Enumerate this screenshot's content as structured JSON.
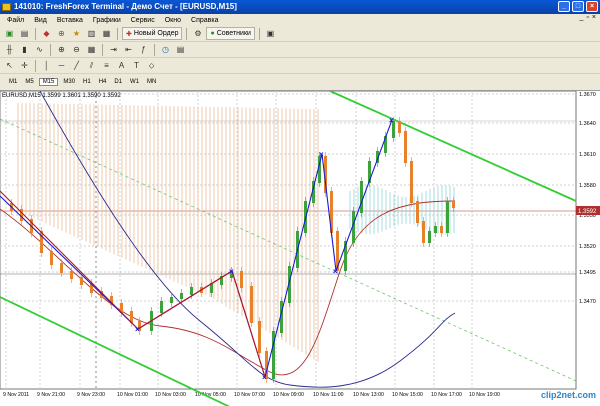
{
  "window": {
    "title": "141010: FreshForex Terminal - Демо Счет - [EURUSD,M15]"
  },
  "menu": [
    "Файл",
    "Вид",
    "Вставка",
    "Графики",
    "Сервис",
    "Окно",
    "Справка"
  ],
  "toolbar": {
    "new_order": "Новый Ордер",
    "advisors": "Советники"
  },
  "timeframes": [
    "M1",
    "M5",
    "M15",
    "M30",
    "H1",
    "H4",
    "D1",
    "W1",
    "MN"
  ],
  "chart": {
    "symbol_label": "EURUSD,M15  1.3599 1.3601 1.3590 1.3592",
    "current_price": "1.3592",
    "price_ticks": [
      "1.3670",
      "1.3640",
      "1.3610",
      "1.3580",
      "1.3550",
      "1.3520",
      "1.3495",
      "1.3470"
    ],
    "time_ticks": [
      "9 Nov 2011",
      "9 Nov 21:00",
      "9 Nov 23:00",
      "10 Nov 01:00",
      "10 Nov 03:00",
      "10 Nov 05:00",
      "10 Nov 07:00",
      "10 Nov 09:00",
      "10 Nov 11:00",
      "10 Nov 13:00",
      "10 Nov 15:00",
      "10 Nov 17:00",
      "10 Nov 19:00"
    ],
    "colors": {
      "bull": "#3ca33c",
      "bear": "#e8822a",
      "channel": "#32cd32",
      "zigzag_blue": "#1a1ad6",
      "zigzag_red": "#c0141e",
      "ma_red": "#b03030",
      "ma_blue": "#2a2a8e",
      "grid": "#d0d0d0"
    }
  },
  "watermark": "clip2net.com"
}
